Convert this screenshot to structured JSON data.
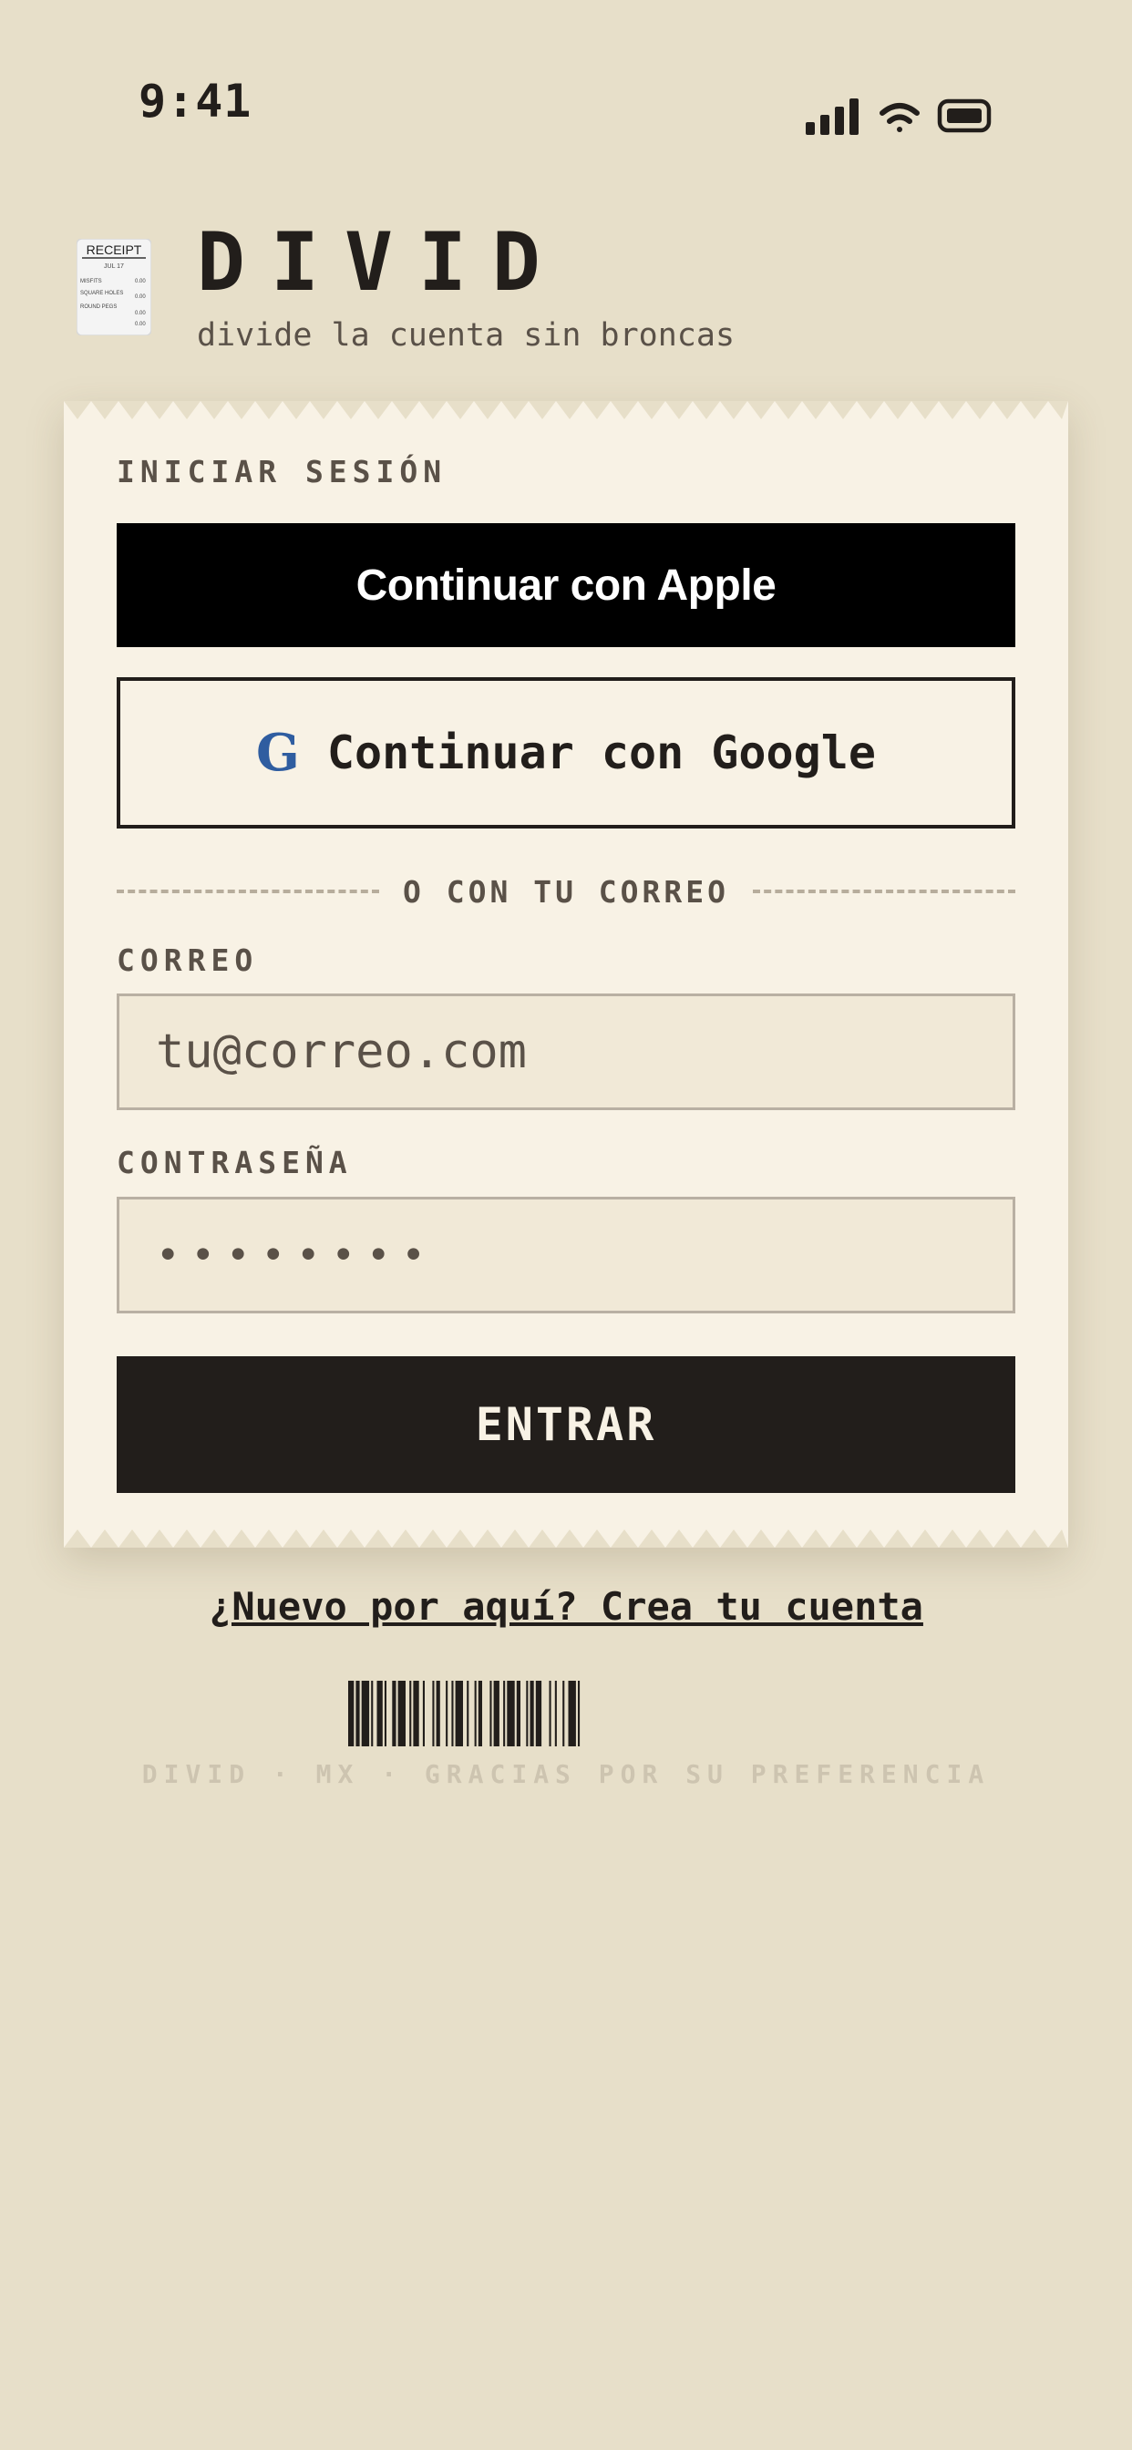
{
  "status_bar": {
    "time": "9:41"
  },
  "header": {
    "brand": "DIVID",
    "tagline": "divide la cuenta sin broncas",
    "logo_lines": [
      "RECEIPT",
      "JUL 17",
      "MISFITS",
      "SQUARE HOLES",
      "ROUND PEGS"
    ]
  },
  "login": {
    "section_label": "INICIAR SESIÓN",
    "apple_button": "Continuar con Apple",
    "google_button": "Continuar con Google",
    "google_icon": "G",
    "divider_text": "O CON TU CORREO",
    "email_label": "CORREO",
    "email_placeholder": "tu@correo.com",
    "password_label": "CONTRASEÑA",
    "password_value": "••••••••",
    "submit_button": "ENTRAR"
  },
  "signup_link": "¿Nuevo por aquí? Crea tu cuenta",
  "footer": "DIVID · MX · GRACIAS POR SU PREFERENCIA",
  "colors": {
    "background": "#e7dfc9",
    "card": "#f8f2e5",
    "ink": "#221e1b",
    "muted": "#5a5148",
    "google_blue": "#2f5da0"
  }
}
